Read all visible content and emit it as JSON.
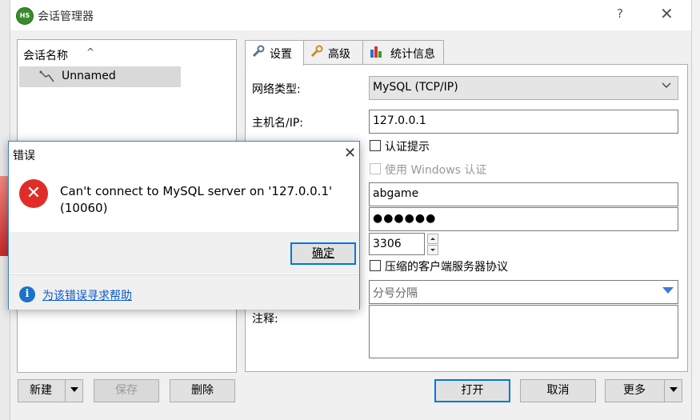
{
  "window": {
    "title": "会话管理器",
    "app_icon": "HS",
    "help_glyph": "?",
    "close_glyph": "✕"
  },
  "tree": {
    "header_label": "会话名称",
    "sort_glyph": "^",
    "items": [
      {
        "label": "Unnamed",
        "icon": "connection-icon"
      }
    ]
  },
  "tabs": [
    {
      "label": "设置",
      "icon": "wrench-icon"
    },
    {
      "label": "高级",
      "icon": "wrench-icon"
    },
    {
      "label": "统计信息",
      "icon": "bar-chart-icon"
    }
  ],
  "settings": {
    "network_type_label": "网络类型:",
    "network_type_value": "MySQL (TCP/IP)",
    "host_label": "主机名/IP:",
    "host_value": "127.0.0.1",
    "auth_prompt_label": "认证提示",
    "windows_auth_label": "使用 Windows 认证",
    "user_value": "abgame",
    "password_value": "●●●●●●",
    "port_value": "3306",
    "compress_label": "压缩的客户端服务器协议",
    "database_value": "分号分隔",
    "comment_label": "注释:"
  },
  "buttons": {
    "new": "新建",
    "save": "保存",
    "delete": "删除",
    "open": "打开",
    "cancel": "取消",
    "more": "更多"
  },
  "error_dialog": {
    "title": "错误",
    "message_line1": "Can't connect to MySQL server on '127.0.0.1'",
    "message_line2": "(10060)",
    "ok_label": "确定",
    "help_link": "为该错误寻求帮助",
    "close_glyph": "✕"
  },
  "colors": {
    "accent": "#0078d7",
    "error": "#e02d27",
    "info": "#1a73c8",
    "link": "#0a58ca"
  }
}
